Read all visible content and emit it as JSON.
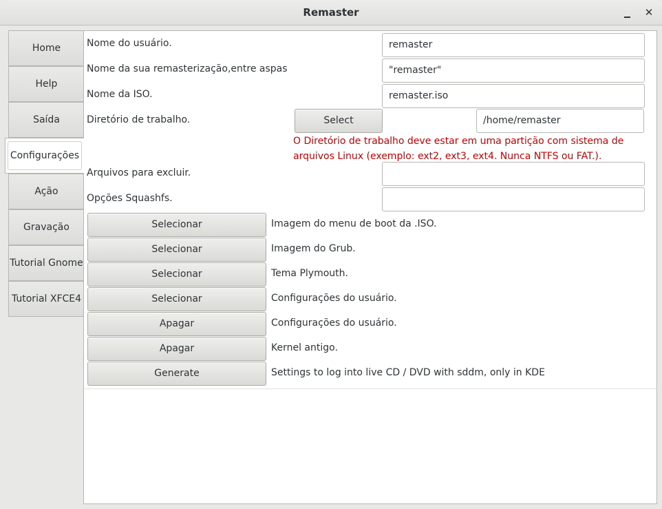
{
  "window": {
    "title": "Remaster",
    "minimize_glyph": "",
    "close_glyph": "✕"
  },
  "tabs": [
    {
      "label": "Home"
    },
    {
      "label": "Help"
    },
    {
      "label": "Saída"
    },
    {
      "label": "Configurações"
    },
    {
      "label": "Ação"
    },
    {
      "label": "Gravação"
    },
    {
      "label": "Tutorial Gnome"
    },
    {
      "label": "Tutorial XFCE4"
    }
  ],
  "active_tab": "Configurações",
  "form": {
    "username": {
      "label": "Nome do usuário.",
      "value": "remaster"
    },
    "remaster_name": {
      "label": "Nome da sua remasterização,entre aspas",
      "value": "\"remaster\""
    },
    "iso_name": {
      "label": "Nome da ISO.",
      "value": "remaster.iso"
    },
    "workdir": {
      "label": "Diretório de trabalho.",
      "button": "Select",
      "value": "/home/remaster"
    },
    "warning": {
      "line1": "O Diretório de trabalho deve estar em uma partição com sistema de",
      "line2": "arquivos Linux (exemplo: ext2, ext3, ext4. Nunca NTFS ou FAT.)."
    },
    "exclude_files": {
      "label": "Arquivos para excluir.",
      "value": ""
    },
    "squashfs_options": {
      "label": "Opções Squashfs.",
      "value": ""
    }
  },
  "actions": [
    {
      "button": "Selecionar",
      "description": "Imagem do menu de boot da .ISO."
    },
    {
      "button": "Selecionar",
      "description": "Imagem do Grub."
    },
    {
      "button": "Selecionar",
      "description": "Tema Plymouth."
    },
    {
      "button": "Selecionar",
      "description": "Configurações do usuário."
    },
    {
      "button": "Apagar",
      "description": "Configurações do usuário."
    },
    {
      "button": "Apagar",
      "description": "Kernel antigo."
    },
    {
      "button": "Generate",
      "description": "Settings to log into live CD / DVD with sddm, only in KDE"
    }
  ],
  "colors": {
    "warning_text": "#cc0000",
    "background": "#e8e8e7",
    "panel": "#ffffff"
  }
}
